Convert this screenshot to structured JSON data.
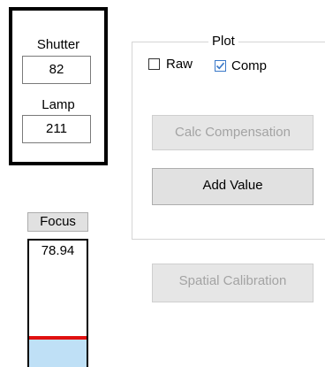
{
  "exposure": {
    "shutter_label": "Shutter",
    "shutter_value": "82",
    "lamp_label": "Lamp",
    "lamp_value": "211"
  },
  "plot": {
    "title": "Plot",
    "raw_label": "Raw",
    "raw_checked": false,
    "comp_label": "Comp",
    "comp_checked": true,
    "calc_compensation_label": "Calc Compensation",
    "calc_compensation_enabled": false,
    "add_value_label": "Add Value",
    "add_value_enabled": true
  },
  "spatial_calibration": {
    "label": "Spatial Calibration",
    "enabled": false
  },
  "focus": {
    "button_label": "Focus",
    "value": "78.94",
    "fill_fraction": 0.22,
    "marker_color": "#e01010",
    "fill_color": "#bfe0f6"
  }
}
